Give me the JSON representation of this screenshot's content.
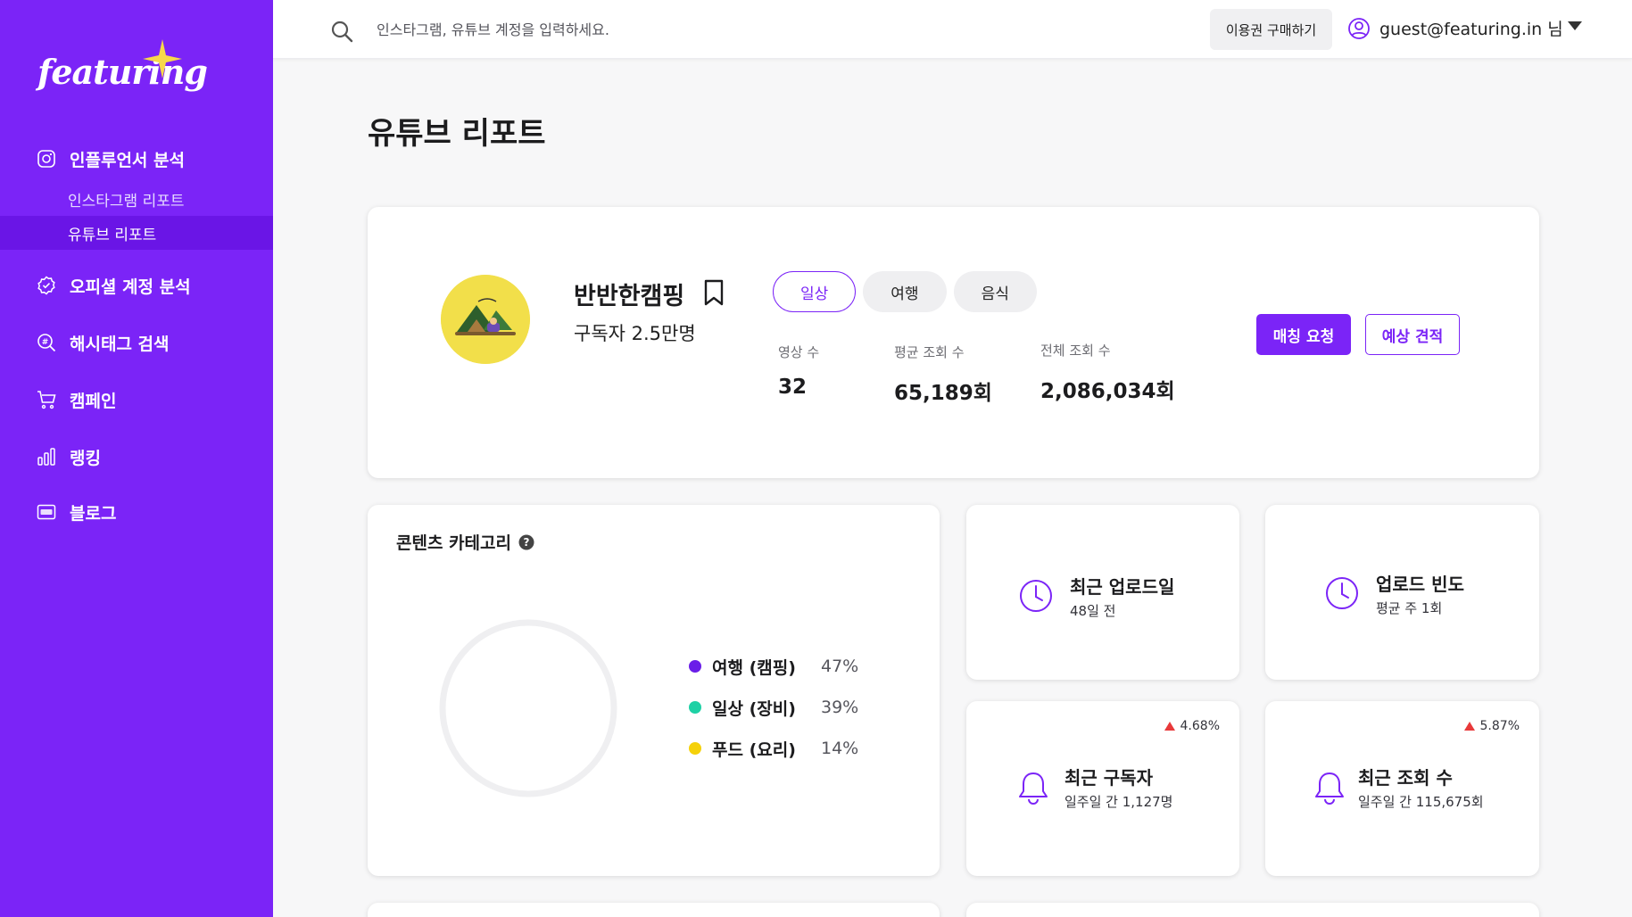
{
  "app": {
    "logo_text": "featuring"
  },
  "sidebar": {
    "groups": [
      {
        "label": "인플루언서 분석",
        "icon": "instagram-icon",
        "children": [
          {
            "label": "인스타그램 리포트",
            "active": false
          },
          {
            "label": "유튜브 리포트",
            "active": true
          }
        ]
      },
      {
        "label": "오피셜 계정 분석",
        "icon": "verified-badge-icon"
      },
      {
        "label": "해시태그 검색",
        "icon": "hashtag-search-icon"
      },
      {
        "label": "캠페인",
        "icon": "cart-icon"
      },
      {
        "label": "랭킹",
        "icon": "bar-chart-icon"
      },
      {
        "label": "블로그",
        "icon": "blog-icon"
      }
    ]
  },
  "header": {
    "search_placeholder": "인스타그램, 유튜브 계정을 입력하세요.",
    "buy_label": "이용권 구매하기",
    "user_email": "guest@featuring.in 님"
  },
  "page": {
    "title": "유튜브 리포트"
  },
  "profile": {
    "channel_name": "반반한캠핑",
    "subscribers": "구독자 2.5만명",
    "tags": [
      {
        "label": "일상",
        "active": true
      },
      {
        "label": "여행",
        "active": false
      },
      {
        "label": "음식",
        "active": false
      }
    ],
    "stats": [
      {
        "label": "영상 수",
        "value": "32"
      },
      {
        "label": "평균 조회 수",
        "value": "65,189회"
      },
      {
        "label": "전체 조회 수",
        "value": "2,086,034회"
      }
    ],
    "match_button": "매칭 요청",
    "quote_button": "예상 견적"
  },
  "content_category": {
    "title": "콘텐츠 카테고리",
    "items": [
      {
        "label": "여행 (캠핑)",
        "percent": "47%",
        "value": 47,
        "color": "#6a1ee8"
      },
      {
        "label": "일상 (장비)",
        "percent": "39%",
        "value": 39,
        "color": "#1ed1a5"
      },
      {
        "label": "푸드 (요리)",
        "percent": "14%",
        "value": 14,
        "color": "#f5d10a"
      }
    ]
  },
  "metrics": {
    "recent_upload": {
      "title": "최근 업로드일",
      "sub": "48일 전"
    },
    "upload_freq": {
      "title": "업로드 빈도",
      "sub": "평균 주 1회"
    },
    "recent_subs": {
      "title": "최근 구독자",
      "sub": "일주일 간 1,127명",
      "trend": "4.68%"
    },
    "recent_views": {
      "title": "최근 조회 수",
      "sub": "일주일 간 115,675회",
      "trend": "5.87%"
    }
  },
  "colors": {
    "brand": "#7b24f7",
    "brand_dark": "#6a15e6",
    "trend_up": "#e8393a"
  }
}
